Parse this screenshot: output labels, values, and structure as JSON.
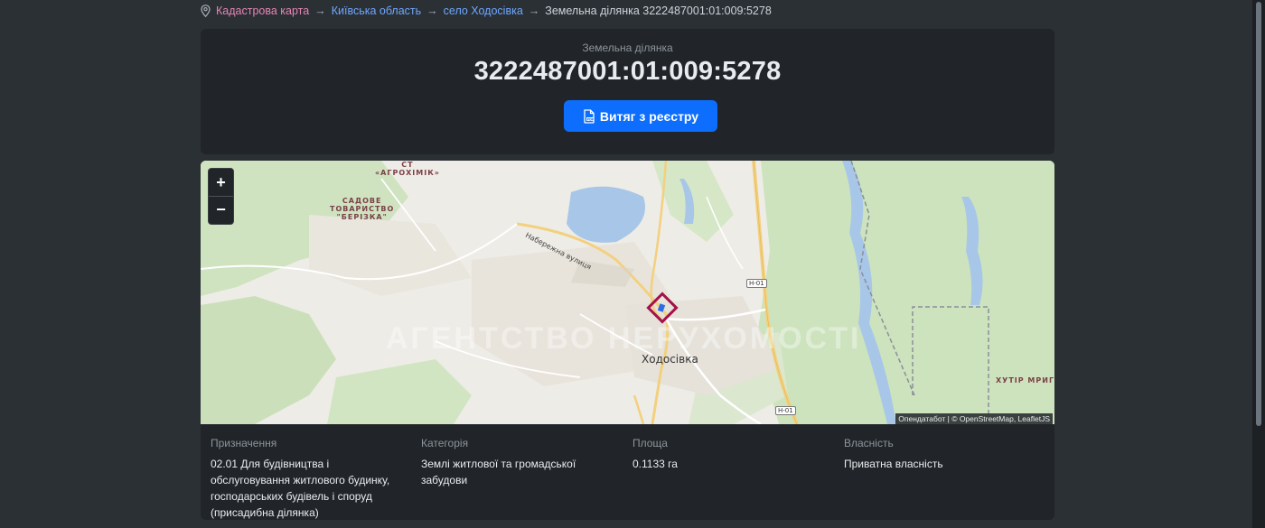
{
  "breadcrumb": {
    "items": [
      {
        "label": "Кадастрова карта"
      },
      {
        "label": "Київська область"
      },
      {
        "label": "село Ходосівка"
      }
    ],
    "separator": "→",
    "current": "Земельна ділянка 3222487001:01:009:5278"
  },
  "hero": {
    "subtitle": "Земельна ділянка",
    "cadastral_number": "3222487001:01:009:5278",
    "button_label": "Витяг з реєстру"
  },
  "map": {
    "zoom_in": "+",
    "zoom_out": "−",
    "attribution": "Опендатабот | © OpenStreetMap, LeafletJS",
    "labels": {
      "st_line1": "СТ",
      "st_line2": "«АГРОХІМІК»",
      "sadove_line1": "САДОВЕ",
      "sadove_line2": "ТОВАРИСТВО",
      "sadove_line3": "\"БЕРІЗКА\"",
      "street": "Набережна вулиця",
      "town": "Ходосівка",
      "road1": "Н-01",
      "road2": "Н-01",
      "khutir": "ХУТІР МРИГИ"
    },
    "watermark": "АГЕНТСТВО НЕРУХОМОСТІ"
  },
  "info": {
    "purpose": {
      "label": "Призначення",
      "value": "02.01 Для будівництва і обслуговування житлового будинку, господарських будівель і споруд (присадибна ділянка)"
    },
    "category": {
      "label": "Категорія",
      "value": "Землі житлової та громадської забудови"
    },
    "area": {
      "label": "Площа",
      "value": "0.1133 га"
    },
    "ownership": {
      "label": "Власність",
      "value": "Приватна власність"
    }
  },
  "colors": {
    "background": "#2b3035",
    "card": "#212529",
    "primary_button": "#0d6efd",
    "parcel_outline": "#a3124a"
  },
  "icons": {
    "breadcrumb": "map-pin-icon",
    "button": "pdf-file-icon"
  }
}
